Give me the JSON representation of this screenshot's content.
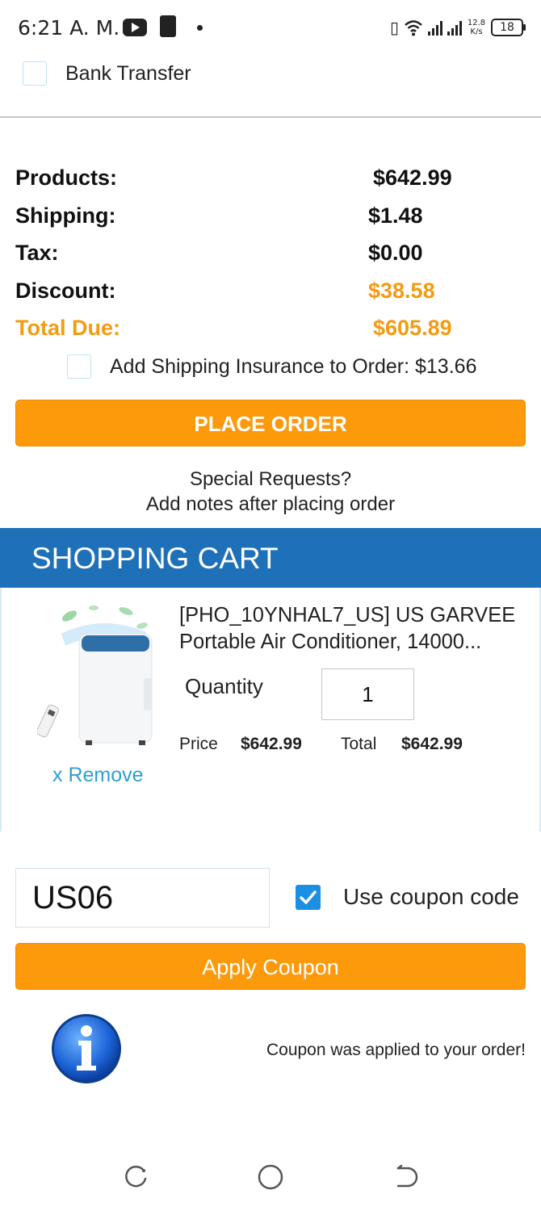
{
  "status_bar": {
    "time": "6:21 A. M.",
    "speed_value": "12.8",
    "speed_unit": "K/s",
    "battery": "18"
  },
  "payment": {
    "bank_transfer_label": "Bank Transfer"
  },
  "totals": {
    "rows": [
      {
        "label": "Products:",
        "value": "$642.99"
      },
      {
        "label": "Shipping:",
        "value": "$1.48"
      },
      {
        "label": "Tax:",
        "value": "$0.00"
      },
      {
        "label": "Discount:",
        "value": "$38.58"
      },
      {
        "label": "Total Due:",
        "value": "$605.89"
      }
    ],
    "accent_color": "#f39b12"
  },
  "insurance": {
    "label": "Add Shipping Insurance to Order: $13.66"
  },
  "place_order": {
    "label": "PLACE ORDER"
  },
  "special_requests": {
    "line1": "Special Requests?",
    "line2": "Add notes after placing order"
  },
  "cart": {
    "title": "SHOPPING CART",
    "header_color": "#1e71b8",
    "item": {
      "name": "[PHO_10YNHAL7_US] US GARVEE Portable Air Conditioner, 14000...",
      "quantity_label": "Quantity",
      "quantity_value": "1",
      "price_label": "Price",
      "price_value": "$642.99",
      "total_label": "Total",
      "total_value": "$642.99",
      "remove_label": "x Remove"
    }
  },
  "coupon": {
    "code_value": "US06",
    "use_coupon_label": "Use coupon code",
    "use_coupon_checked": true,
    "apply_label": "Apply Coupon",
    "message": "Coupon was applied to your order!"
  },
  "icons": {
    "info": "info-icon",
    "nav_recent": "recent-apps-icon",
    "nav_home": "home-icon",
    "nav_back": "back-icon"
  }
}
